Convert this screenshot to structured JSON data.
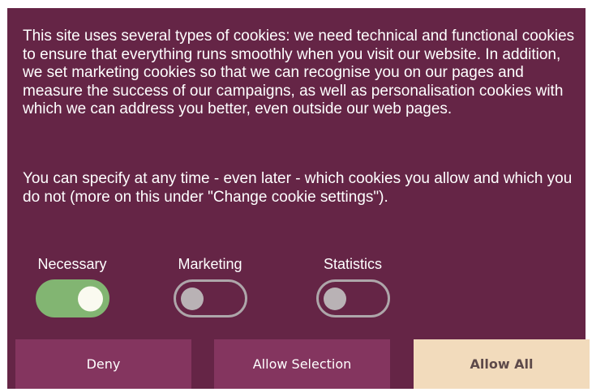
{
  "cookie_banner": {
    "paragraph_1": "This site uses several types of cookies: we need technical and functional cookies to ensure that everything runs smoothly when you visit our website. In addition, we set marketing cookies so that we can recognise you on our pages and measure the success of our campaigns, as well as personalisation cookies with which we can address you better, even outside our web pages.",
    "paragraph_2": "You can specify at any time - even later - which cookies you allow and which you do not (more on this under \"Change cookie settings\").",
    "toggles": [
      {
        "label": "Necessary",
        "state": "on"
      },
      {
        "label": "Marketing",
        "state": "off"
      },
      {
        "label": "Statistics",
        "state": "off"
      }
    ],
    "buttons": {
      "deny": "Deny",
      "allow_selection": "Allow Selection",
      "allow_all": "Allow All"
    },
    "colors": {
      "background": "#652546",
      "button_secondary": "#84355f",
      "button_primary": "#f2dbbc",
      "toggle_on": "#82b572",
      "toggle_off_border": "#aea6aa"
    }
  }
}
